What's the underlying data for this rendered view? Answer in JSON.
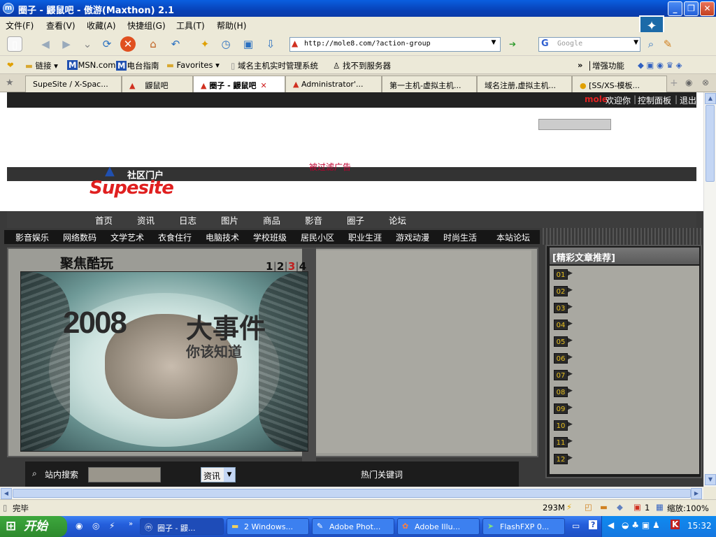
{
  "window": {
    "title": "圈子 - 鼹鼠吧 - 傲游(Maxthon) 2.1"
  },
  "menu": [
    "文件(F)",
    "查看(V)",
    "收藏(A)",
    "快捷组(G)",
    "工具(T)",
    "帮助(H)"
  ],
  "address": {
    "url": "http://mole8.com/?action-group"
  },
  "search": {
    "placeholder": "Google"
  },
  "links": [
    "链接",
    "MSN.com",
    "电台指南",
    "Favorites",
    "域名主机实时管理系统",
    "找不到服务器",
    "增强功能"
  ],
  "tabs": [
    {
      "label": "SupeSite / X-Spac..."
    },
    {
      "label": "鼹鼠吧"
    },
    {
      "label": "圈子 - 鼹鼠吧"
    },
    {
      "label": "Administrator'..."
    },
    {
      "label": "第一主机-虚拟主机..."
    },
    {
      "label": "域名注册,虚拟主机..."
    },
    {
      "label": "[SS/XS-模板..."
    }
  ],
  "site": {
    "user_name": "mole",
    "welcome": "欢迎你",
    "control_panel": "控制面板",
    "logout": "退出",
    "ad_filtered": "被过滤广告",
    "logo_sub": "社区门户",
    "logo_main": "Supesite",
    "main_nav": [
      "首页",
      "资讯",
      "日志",
      "图片",
      "商品",
      "影音",
      "圈子",
      "论坛"
    ],
    "cat_nav": [
      "影音娱乐",
      "网络数码",
      "文学艺术",
      "衣食住行",
      "电脑技术",
      "学校班级",
      "居民小区",
      "职业生涯",
      "游戏动漫",
      "时尚生活",
      "本站论坛"
    ],
    "focus_title": "聚焦酷玩",
    "focus_pages": [
      "1",
      "2",
      "3",
      "4"
    ],
    "focus_active_page": "3",
    "banner_year": "2008",
    "banner_big": "大事件",
    "banner_small": "你该知道",
    "recommend_title": "[精彩文章推荐]",
    "recommend_nums": [
      "01",
      "02",
      "03",
      "04",
      "05",
      "06",
      "07",
      "08",
      "09",
      "10",
      "11",
      "12"
    ],
    "search_label": "站内搜索",
    "search_select": "资讯",
    "hot_keywords": "热门关键词"
  },
  "status": {
    "text": "完毕",
    "memory": "293M",
    "count": "1",
    "zoom": "缩放:100%"
  },
  "taskbar": {
    "start": "开始",
    "tasks": [
      "圈子 - 鼹...",
      "2 Windows...",
      "Adobe Phot...",
      "Adobe Illu...",
      "FlashFXP 0..."
    ],
    "clock": "15:32"
  }
}
